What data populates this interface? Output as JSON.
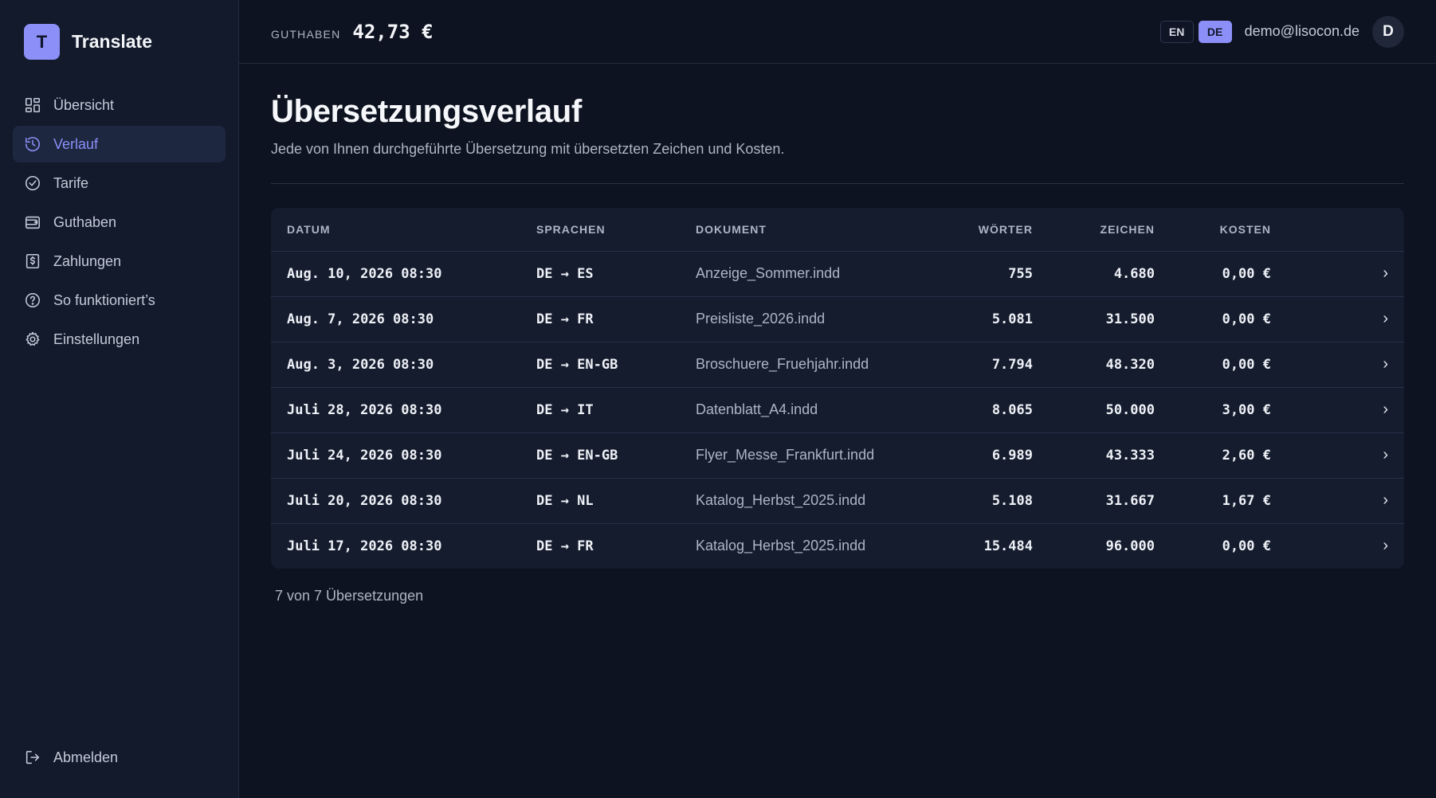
{
  "brand": {
    "logo_letter": "T",
    "name": "Translate"
  },
  "sidebar": {
    "items": [
      {
        "label": "Übersicht",
        "icon": "grid-icon",
        "active": false
      },
      {
        "label": "Verlauf",
        "icon": "history-icon",
        "active": true
      },
      {
        "label": "Tarife",
        "icon": "check-circle-icon",
        "active": false
      },
      {
        "label": "Guthaben",
        "icon": "wallet-icon",
        "active": false
      },
      {
        "label": "Zahlungen",
        "icon": "receipt-icon",
        "active": false
      },
      {
        "label": "So funktioniert’s",
        "icon": "help-circle-icon",
        "active": false
      },
      {
        "label": "Einstellungen",
        "icon": "gear-icon",
        "active": false
      }
    ],
    "logout_label": "Abmelden"
  },
  "header": {
    "balance_label": "GUTHABEN",
    "balance_value": "42,73 €",
    "languages": [
      "EN",
      "DE"
    ],
    "active_language": "DE",
    "user_email": "demo@lisocon.de",
    "avatar_letter": "D"
  },
  "main": {
    "title": "Übersetzungsverlauf",
    "subtitle": "Jede von Ihnen durchgeführte Übersetzung mit übersetzten Zeichen und Kosten.",
    "table": {
      "columns": [
        "DATUM",
        "SPRACHEN",
        "DOKUMENT",
        "WÖRTER",
        "ZEICHEN",
        "KOSTEN"
      ],
      "rows": [
        {
          "date": "Aug. 10, 2026 08:30",
          "languages": "DE → ES",
          "document": "Anzeige_Sommer.indd",
          "words": "755",
          "chars": "4.680",
          "cost": "0,00 €"
        },
        {
          "date": "Aug. 7, 2026 08:30",
          "languages": "DE → FR",
          "document": "Preisliste_2026.indd",
          "words": "5.081",
          "chars": "31.500",
          "cost": "0,00 €"
        },
        {
          "date": "Aug. 3, 2026 08:30",
          "languages": "DE → EN-GB",
          "document": "Broschuere_Fruehjahr.indd",
          "words": "7.794",
          "chars": "48.320",
          "cost": "0,00 €"
        },
        {
          "date": "Juli 28, 2026 08:30",
          "languages": "DE → IT",
          "document": "Datenblatt_A4.indd",
          "words": "8.065",
          "chars": "50.000",
          "cost": "3,00 €"
        },
        {
          "date": "Juli 24, 2026 08:30",
          "languages": "DE → EN-GB",
          "document": "Flyer_Messe_Frankfurt.indd",
          "words": "6.989",
          "chars": "43.333",
          "cost": "2,60 €"
        },
        {
          "date": "Juli 20, 2026 08:30",
          "languages": "DE → NL",
          "document": "Katalog_Herbst_2025.indd",
          "words": "5.108",
          "chars": "31.667",
          "cost": "1,67 €"
        },
        {
          "date": "Juli 17, 2026 08:30",
          "languages": "DE → FR",
          "document": "Katalog_Herbst_2025.indd",
          "words": "15.484",
          "chars": "96.000",
          "cost": "0,00 €"
        }
      ],
      "row_arrow": "›"
    },
    "footer_count": "7 von 7 Übersetzungen"
  },
  "colors": {
    "accent": "#8b8ff7",
    "background": "#0d1320",
    "sidebar": "#121a2c",
    "table": "#141c2e"
  }
}
